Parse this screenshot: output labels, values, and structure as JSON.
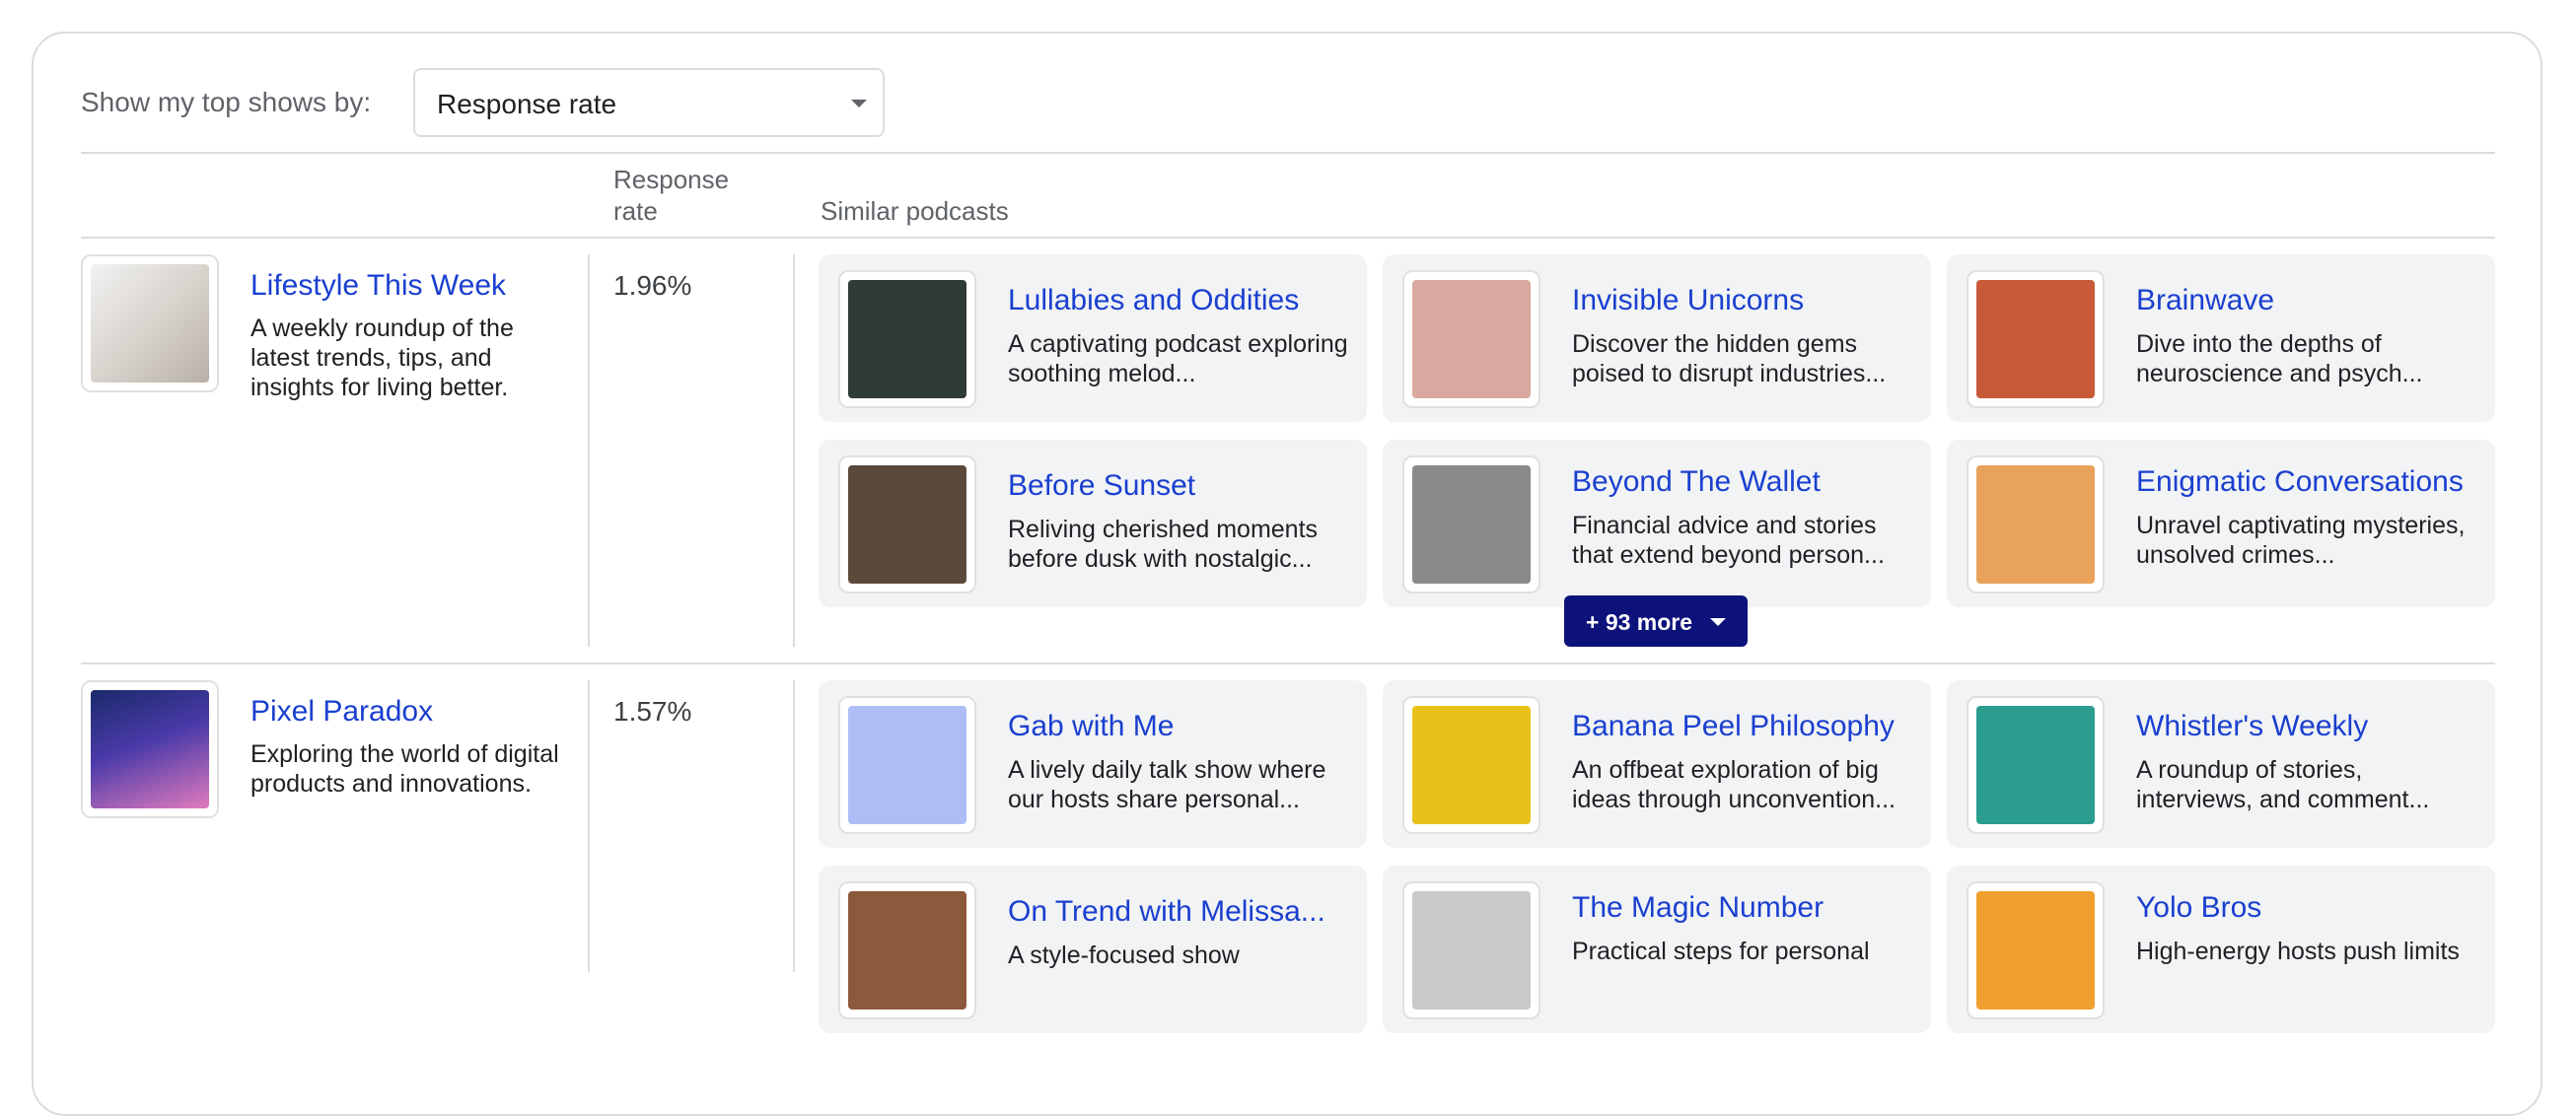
{
  "filter": {
    "label": "Show my top shows by:",
    "selected": "Response rate"
  },
  "columns": {
    "response_rate": "Response rate",
    "similar": "Similar podcasts"
  },
  "shows": [
    {
      "title": "Lifestyle This Week",
      "description": "A weekly roundup of the latest trends, tips, and insights for living better.",
      "rate": "1.96%",
      "more_label": "+ 93 more",
      "similar": [
        {
          "title": "Lullabies and Oddities",
          "description": "A captivating podcast exploring soothing melod...",
          "art_color": "#2f3b36"
        },
        {
          "title": "Invisible Unicorns",
          "description": "Discover the hidden gems poised to disrupt industries...",
          "art_color": "#d9a89e"
        },
        {
          "title": "Brainwave",
          "description": "Dive into the depths of neuroscience and psych...",
          "art_color": "#c85a3a"
        },
        {
          "title": "Before Sunset",
          "description": "Reliving cherished moments before dusk with nostalgic...",
          "art_color": "#5b4a3c"
        },
        {
          "title": "Beyond The Wallet",
          "description": "Financial advice and stories that extend beyond person...",
          "art_color": "#8a8a8a"
        },
        {
          "title": "Enigmatic Conversations",
          "description": "Unravel captivating mysteries, unsolved crimes...",
          "art_color": "#e9a25a"
        }
      ]
    },
    {
      "title": "Pixel Paradox",
      "description": "Exploring the world of digital products and innovations.",
      "rate": "1.57%",
      "similar": [
        {
          "title": "Gab with Me",
          "description": "A lively daily talk show where our hosts share personal...",
          "art_color": "#aebdf5"
        },
        {
          "title": "Banana Peel Philosophy",
          "description": "An offbeat exploration of big ideas through unconvention...",
          "art_color": "#e8c21a"
        },
        {
          "title": "Whistler's Weekly",
          "description": "A roundup of stories, interviews, and comment...",
          "art_color": "#2a9d8f"
        },
        {
          "title": "On Trend with Melissa...",
          "description": "A style-focused show",
          "art_color": "#8b5a3c"
        },
        {
          "title": "The Magic Number",
          "description": "Practical steps for personal",
          "art_color": "#c9c9c9"
        },
        {
          "title": "Yolo Bros",
          "description": "High-energy hosts push limits",
          "art_color": "#f0a030"
        }
      ]
    }
  ]
}
